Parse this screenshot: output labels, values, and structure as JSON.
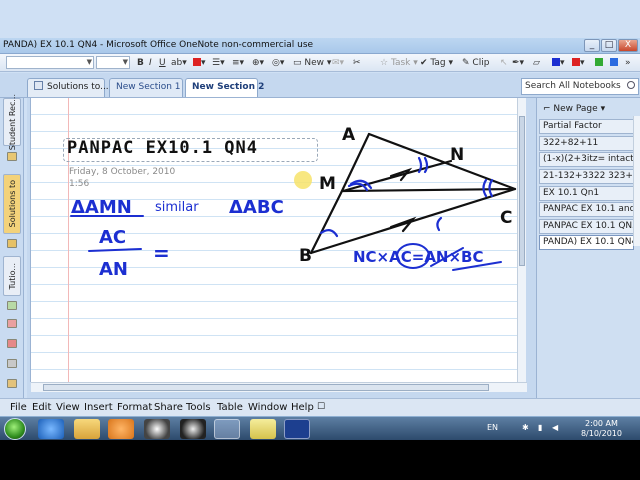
{
  "window": {
    "title": "PANDA) EX 10.1 QN4 - Microsoft Office OneNote non-commercial use",
    "buttons": [
      "_",
      "□",
      "X"
    ]
  },
  "toolbar": {
    "new_label": "New",
    "task_label": "Task",
    "tag_label": "Tag",
    "clip_label": "Clip"
  },
  "tabs": [
    {
      "label": "Solutions to..."
    },
    {
      "label": "New Section 1"
    },
    {
      "label": "New Section 2"
    }
  ],
  "search": {
    "placeholder": "Search All Notebooks"
  },
  "notebooks": [
    {
      "label": "Student Rec..."
    },
    {
      "label": "Solutions to"
    },
    {
      "label": "Tutio..."
    }
  ],
  "page": {
    "title": "PANPAC EX10.1 QN4",
    "date": "Friday, 8 October, 2010",
    "time": "1:56",
    "ink_color": "#1c2fd1"
  },
  "page_tabs": {
    "new_page": "New Page",
    "items": [
      {
        "label": "Partial Factor"
      },
      {
        "label": "322+82+11"
      },
      {
        "label": "(1-x)(2+3itz= intact B"
      },
      {
        "label": "21-132+3322  323+3"
      },
      {
        "label": "EX 10.1 Qn1"
      },
      {
        "label": "PANPAC EX 10.1 and"
      },
      {
        "label": "PANPAC EX 10.1 QN3"
      },
      {
        "label": "PANDA) EX 10.1 QN4"
      }
    ]
  },
  "menu": [
    "File",
    "Edit",
    "View",
    "Insert",
    "Format",
    "Share",
    "Tools",
    "Table",
    "Window",
    "Help"
  ],
  "tray": {
    "lang": "EN",
    "time": "2:00 AM",
    "date": "8/10/2010"
  }
}
